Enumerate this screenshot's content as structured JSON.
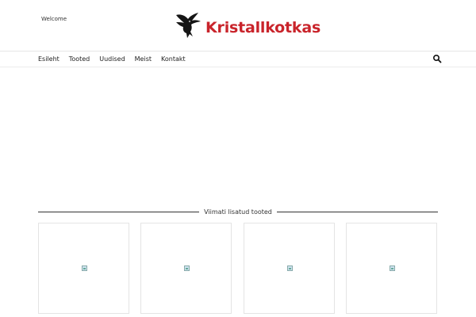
{
  "header": {
    "welcome_text": "Welcome",
    "brand_name": "Kristallkotkas",
    "brand_color": "#c9242b",
    "logo_icon": "eagle-icon"
  },
  "nav": {
    "items": [
      {
        "label": "Esileht"
      },
      {
        "label": "Tooted"
      },
      {
        "label": "Uudised"
      },
      {
        "label": "Meist"
      },
      {
        "label": "Kontakt"
      }
    ],
    "search_icon": "search-icon"
  },
  "products_section": {
    "title": "Viimati lisatud tooted",
    "cards": [
      {
        "image": "broken-image-icon"
      },
      {
        "image": "broken-image-icon"
      },
      {
        "image": "broken-image-icon"
      },
      {
        "image": "broken-image-icon"
      }
    ]
  }
}
